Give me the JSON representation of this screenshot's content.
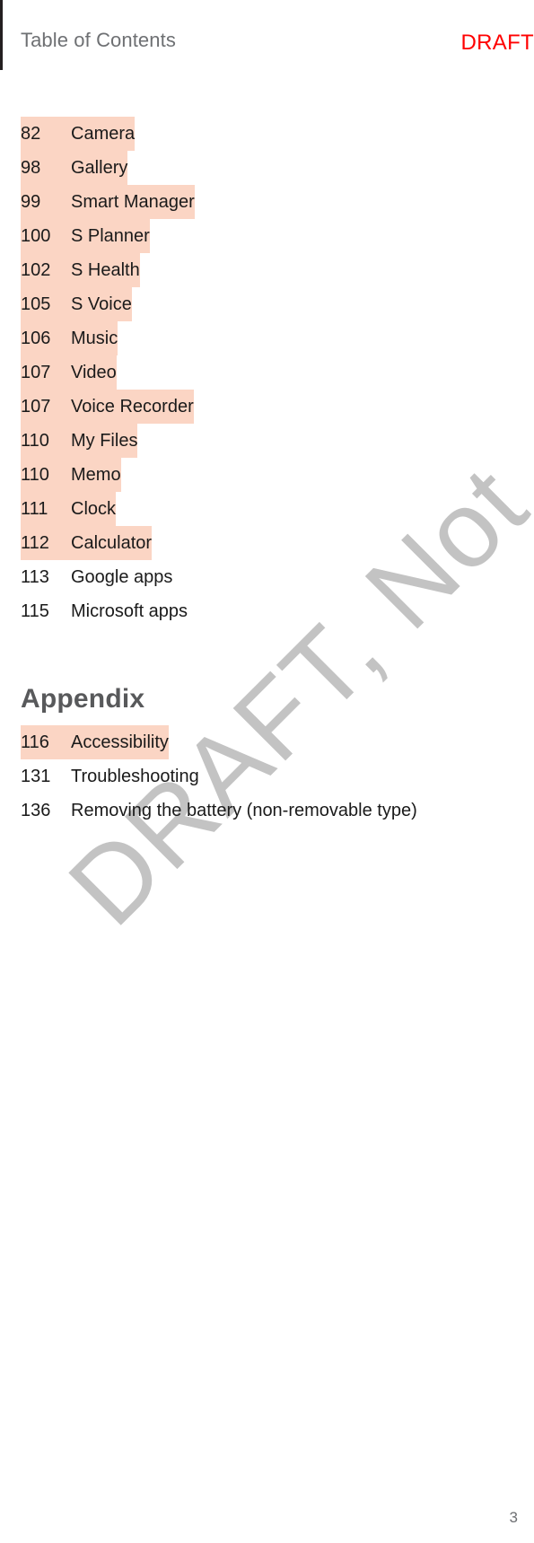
{
  "header": {
    "title": "Table of Contents",
    "draft_label": "DRAFT"
  },
  "watermark": {
    "text": "DRAFT, Not"
  },
  "colors": {
    "highlight": "#fbd5c4",
    "draft_red": "#ff0000",
    "heading_gray": "#58595b",
    "header_gray": "#6e7073",
    "watermark_gray": "#c3c3c3",
    "body_text": "#1a1a1a"
  },
  "apps_section": {
    "entries": [
      {
        "page": "82",
        "label": "Camera",
        "highlighted": true
      },
      {
        "page": "98",
        "label": "Gallery",
        "highlighted": true
      },
      {
        "page": "99",
        "label": "Smart Manager",
        "highlighted": true
      },
      {
        "page": "100",
        "label": "S Planner",
        "highlighted": true
      },
      {
        "page": "102",
        "label": "S Health",
        "highlighted": true
      },
      {
        "page": "105",
        "label": "S Voice",
        "highlighted": true
      },
      {
        "page": "106",
        "label": "Music",
        "highlighted": true
      },
      {
        "page": "107",
        "label": "Video",
        "highlighted": true
      },
      {
        "page": "107",
        "label": "Voice Recorder",
        "highlighted": true
      },
      {
        "page": "110",
        "label": "My Files",
        "highlighted": true
      },
      {
        "page": "110",
        "label": "Memo",
        "highlighted": true
      },
      {
        "page": "111",
        "label": "Clock",
        "highlighted": true
      },
      {
        "page": "112",
        "label": "Calculator",
        "highlighted": true
      },
      {
        "page": "113",
        "label": "Google apps",
        "highlighted": false
      },
      {
        "page": "115",
        "label": "Microsoft apps",
        "highlighted": false
      }
    ]
  },
  "appendix_section": {
    "heading": "Appendix",
    "entries": [
      {
        "page": "116",
        "label": "Accessibility",
        "highlighted": true
      },
      {
        "page": "131",
        "label": "Troubleshooting",
        "highlighted": false
      },
      {
        "page": "136",
        "label": "Removing the battery (non-removable type)",
        "highlighted": false
      }
    ]
  },
  "footer": {
    "page_number": "3"
  }
}
